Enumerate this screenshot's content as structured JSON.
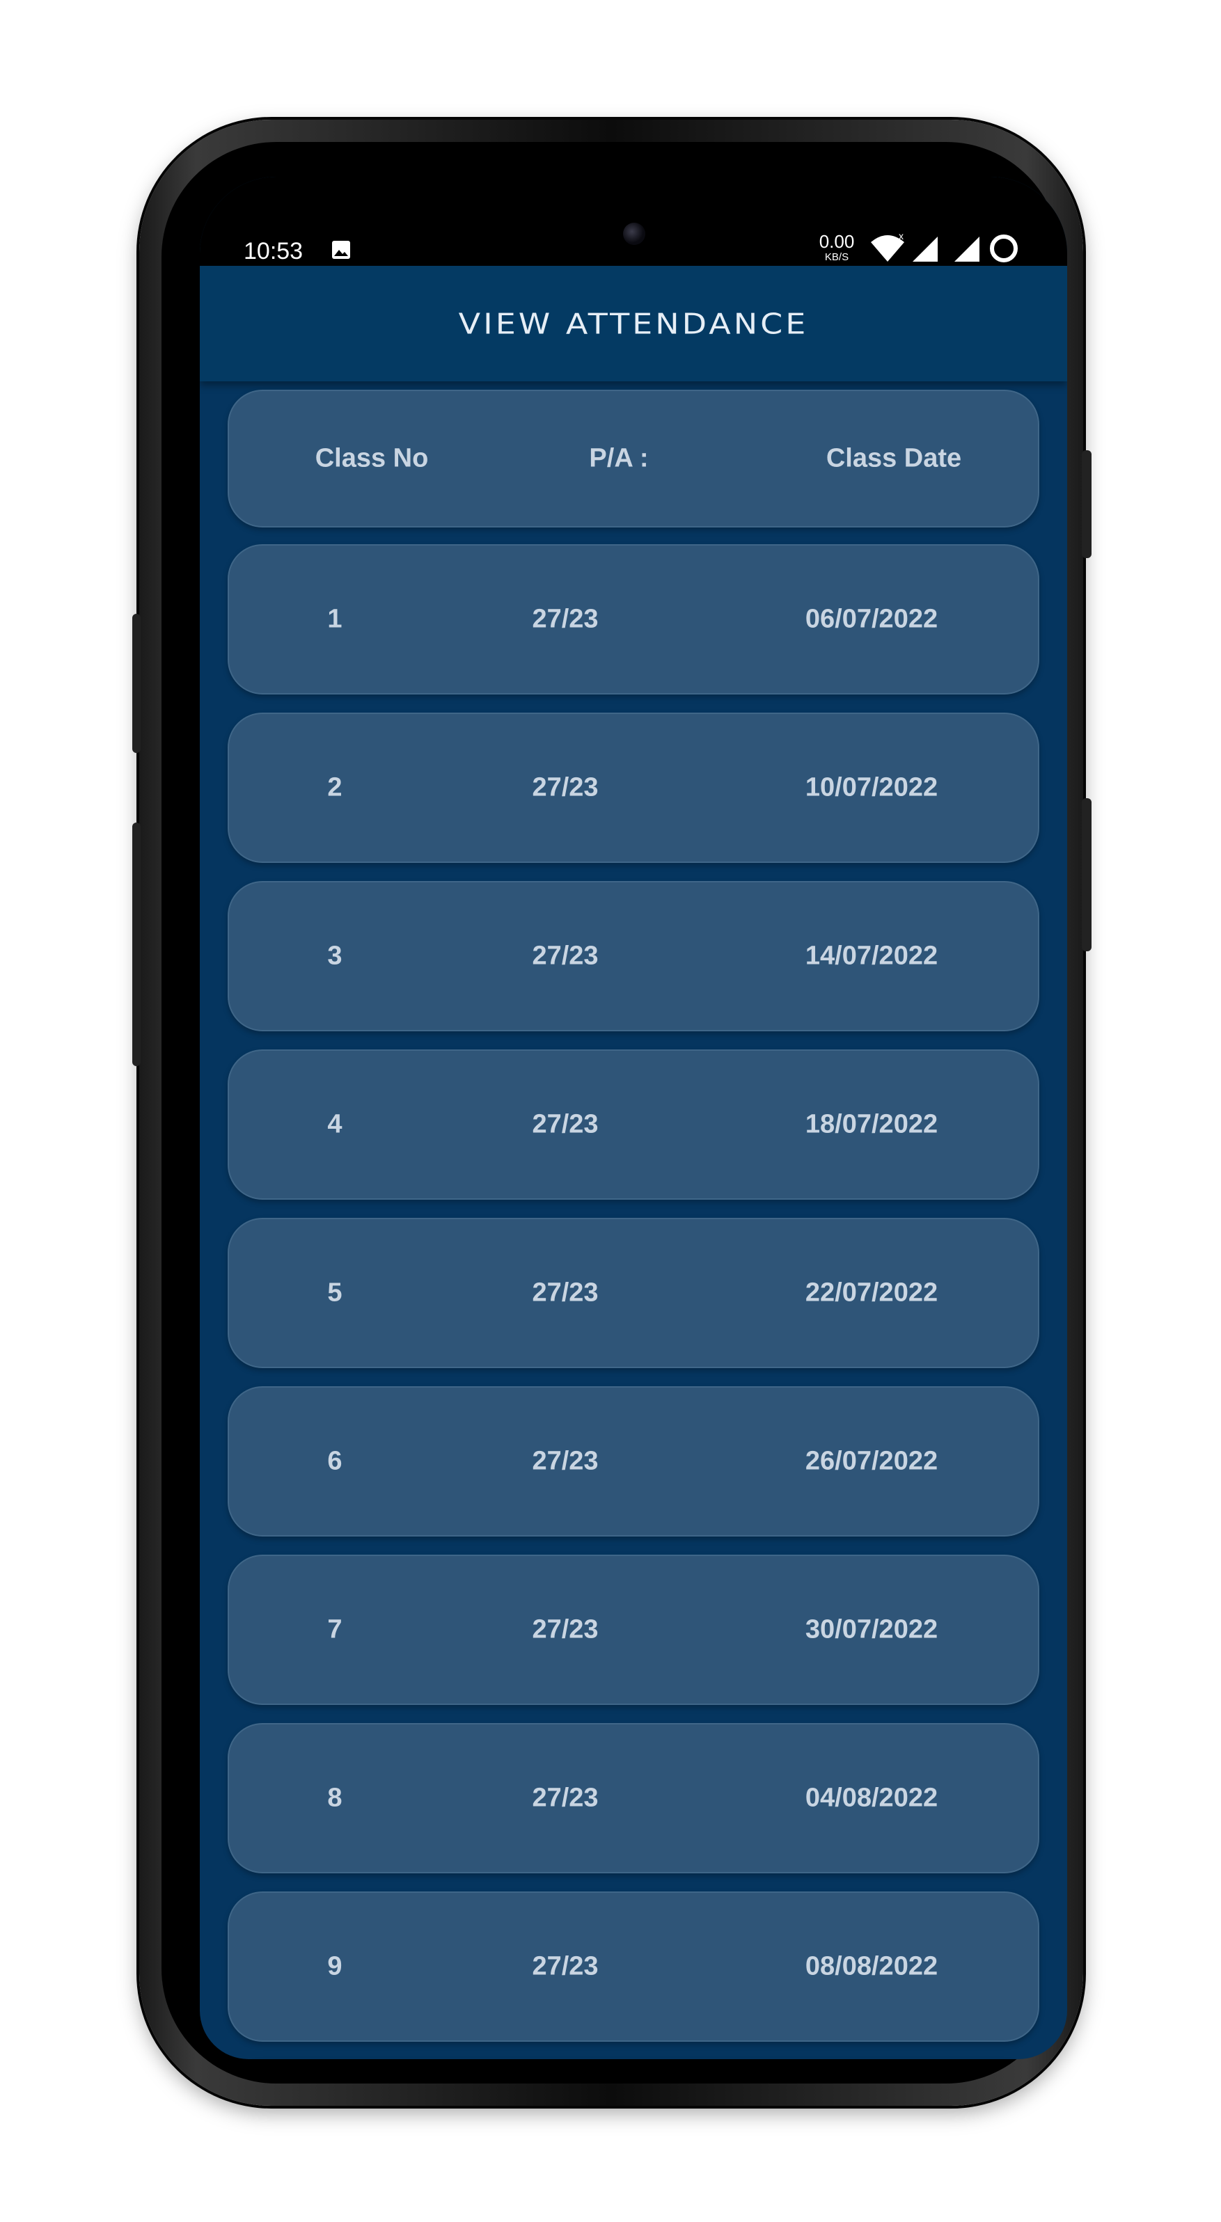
{
  "status_bar": {
    "time": "10:53",
    "net_speed_value": "0.00",
    "net_speed_unit": "KB/S",
    "icons": [
      "image-icon",
      "wifi-icon",
      "signal-icon",
      "signal-icon",
      "battery-ring-icon"
    ]
  },
  "app_bar": {
    "title": "VIEW ATTENDANCE"
  },
  "table": {
    "headers": [
      "Class No",
      "P/A :",
      "Class Date"
    ],
    "rows": [
      {
        "class_no": "1",
        "pa": "27/23",
        "date": "06/07/2022"
      },
      {
        "class_no": "2",
        "pa": "27/23",
        "date": "10/07/2022"
      },
      {
        "class_no": "3",
        "pa": "27/23",
        "date": "14/07/2022"
      },
      {
        "class_no": "4",
        "pa": "27/23",
        "date": "18/07/2022"
      },
      {
        "class_no": "5",
        "pa": "27/23",
        "date": "22/07/2022"
      },
      {
        "class_no": "6",
        "pa": "27/23",
        "date": "26/07/2022"
      },
      {
        "class_no": "7",
        "pa": "27/23",
        "date": "30/07/2022"
      },
      {
        "class_no": "8",
        "pa": "27/23",
        "date": "04/08/2022"
      },
      {
        "class_no": "9",
        "pa": "27/23",
        "date": "08/08/2022"
      }
    ]
  },
  "colors": {
    "background": "#05355f",
    "app_bar": "#043a63",
    "card": "#2f5578",
    "text": "#c9d5e2"
  }
}
